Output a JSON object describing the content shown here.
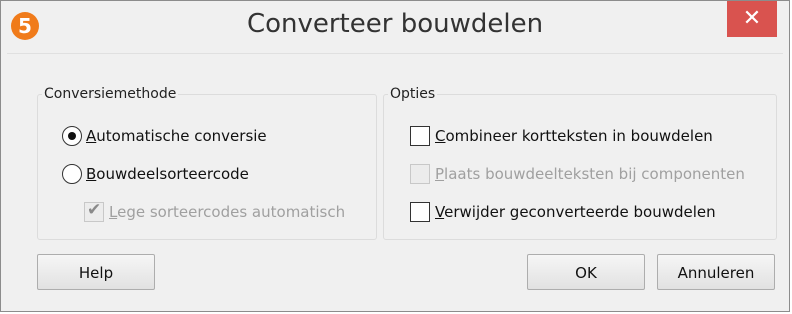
{
  "window": {
    "title": "Converteer bouwdelen",
    "icon_text": "5",
    "close_glyph": "✕"
  },
  "conversion": {
    "legend": "Conversiemethode",
    "auto_first": "A",
    "auto_rest": "utomatische conversie",
    "sort_first": "B",
    "sort_rest": "ouwdeelsorteercode",
    "empty_first": "L",
    "empty_rest": "ege sorteercodes automatisch"
  },
  "options": {
    "legend": "Opties",
    "combine_first": "C",
    "combine_rest": "ombineer kortteksten in bouwdelen",
    "place_first": "P",
    "place_rest": "laats bouwdeelteksten bij componenten",
    "delete_first": "V",
    "delete_rest": "erwijder geconverteerde bouwdelen"
  },
  "buttons": {
    "help": "Help",
    "ok": "OK",
    "cancel": "Annuleren"
  },
  "colors": {
    "close": "#d9534f",
    "icon": "#f07b1a",
    "background": "#f0f0f0"
  },
  "icons": {
    "app": "app-logo-icon",
    "close": "close-icon"
  }
}
